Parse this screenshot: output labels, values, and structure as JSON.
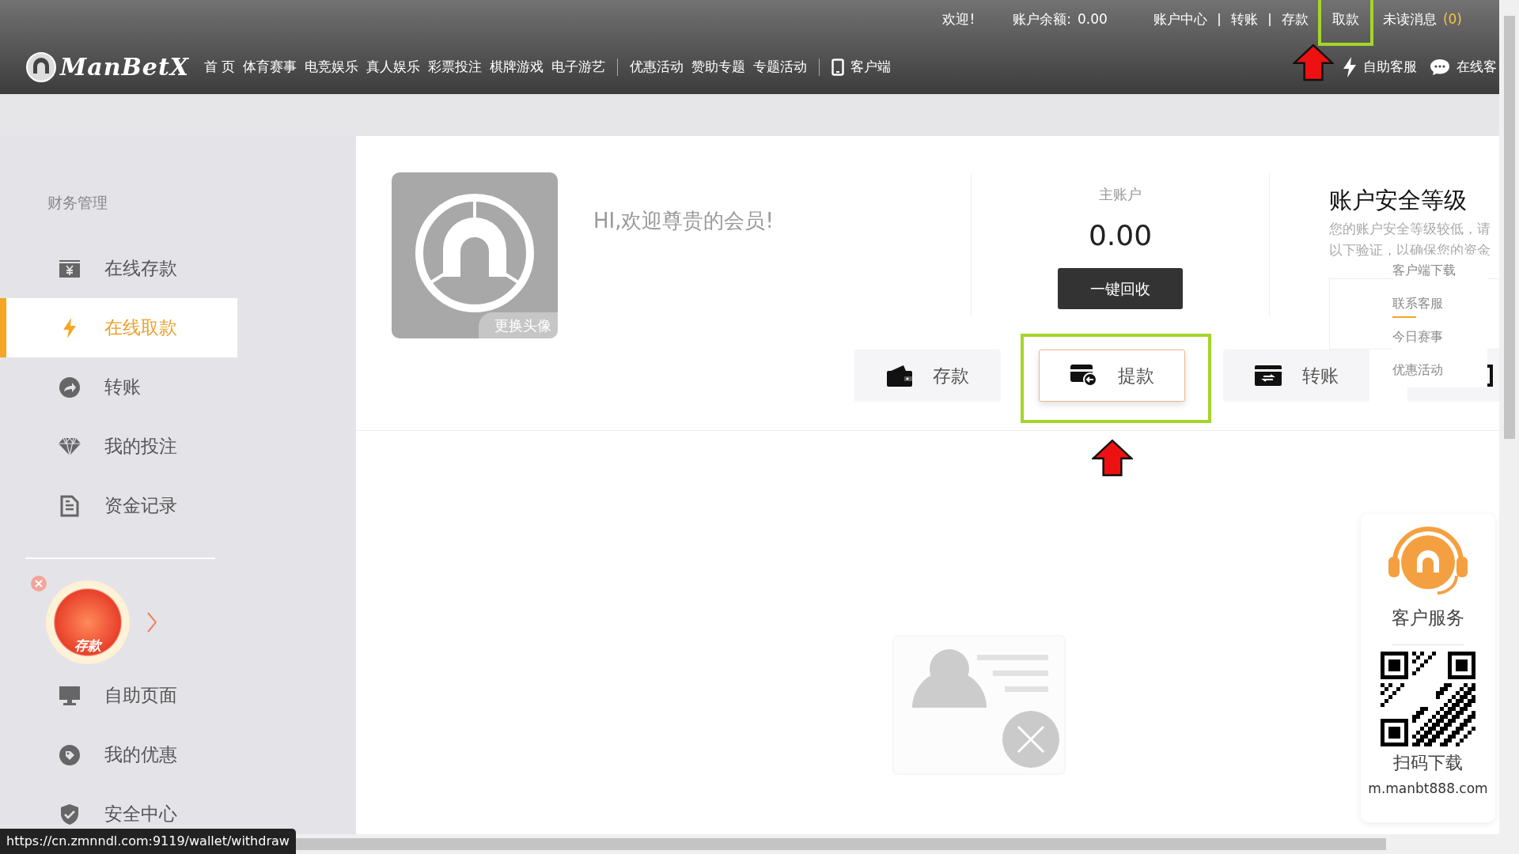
{
  "top_bar": {
    "welcome": "欢迎!",
    "balance_label": "账户余额:",
    "balance": "0.00",
    "links": [
      {
        "label": "账户中心",
        "highlighted": false
      },
      {
        "label": "转账",
        "highlighted": false
      },
      {
        "label": "存款",
        "highlighted": false
      },
      {
        "label": "取款",
        "highlighted": true
      }
    ],
    "unread": {
      "label": "未读消息",
      "count": "(0)"
    }
  },
  "logo": "ManBetX",
  "nav": {
    "groups": [
      [
        {
          "label": "首 页",
          "kind": "text"
        },
        {
          "label": "体育赛事",
          "kind": "text"
        },
        {
          "label": "电竞娱乐",
          "kind": "text"
        },
        {
          "label": "真人娱乐",
          "kind": "text"
        },
        {
          "label": "彩票投注",
          "kind": "text"
        },
        {
          "label": "棋牌游戏",
          "kind": "text"
        },
        {
          "label": "电子游艺",
          "kind": "text"
        }
      ],
      [
        {
          "label": "优惠活动",
          "kind": "text"
        },
        {
          "label": "赞助专题",
          "kind": "text"
        },
        {
          "label": "专题活动",
          "kind": "text"
        }
      ],
      [
        {
          "label": "客户端",
          "kind": "app"
        }
      ]
    ],
    "tools": [
      {
        "label": "自助客服",
        "kind": "selfhelp"
      },
      {
        "label": "在线客",
        "kind": "chat"
      }
    ]
  },
  "sidebar": {
    "title": "财务管理",
    "items": [
      {
        "label": "在线存款",
        "kind": "deposit",
        "selected": false
      },
      {
        "label": "在线取款",
        "kind": "withdraw",
        "selected": true
      },
      {
        "label": "转账",
        "kind": "transfer",
        "selected": false
      },
      {
        "label": "我的投注",
        "kind": "bets",
        "selected": false
      },
      {
        "label": "资金记录",
        "kind": "records",
        "selected": false
      }
    ],
    "promo": {
      "label": "存款"
    },
    "more_items": [
      {
        "label": "自助页面",
        "kind": "selfhelp",
        "selected": false
      },
      {
        "label": "我的优惠",
        "kind": "offers",
        "selected": false
      },
      {
        "label": "安全中心",
        "kind": "security",
        "selected": false
      }
    ]
  },
  "status_url": "https://cn.zmnndl.com:9119/wallet/withdraw",
  "profile": {
    "avatar_caption": "更换头像",
    "greeting": "HI,欢迎尊贵的会员!"
  },
  "wallet": {
    "label": "主账户",
    "amount": "0.00",
    "button": "一键回收"
  },
  "security": {
    "title": "账户安全等级",
    "lines": [
      "您的账户安全等级较低，请",
      "以下验证，以确保您的资金"
    ]
  },
  "quick_menu": [
    {
      "label": "客户端下载",
      "selected": false
    },
    {
      "label": "联系客服",
      "selected": true
    },
    {
      "label": "今日赛事",
      "selected": false
    },
    {
      "label": "优惠活动",
      "selected": false
    }
  ],
  "actions": [
    {
      "label": "存款",
      "kind": "deposit",
      "selected": false,
      "highlighted": false
    },
    {
      "label": "提款",
      "kind": "withdraw",
      "selected": true,
      "highlighted": true
    },
    {
      "label": "转账",
      "kind": "transfer",
      "selected": false,
      "highlighted": false
    },
    {
      "kind": "records",
      "selected": false,
      "highlighted": false
    }
  ],
  "service_panel": {
    "title": "客户服务",
    "qr_caption": "扫码下载",
    "url": "m.manbt888.com"
  }
}
